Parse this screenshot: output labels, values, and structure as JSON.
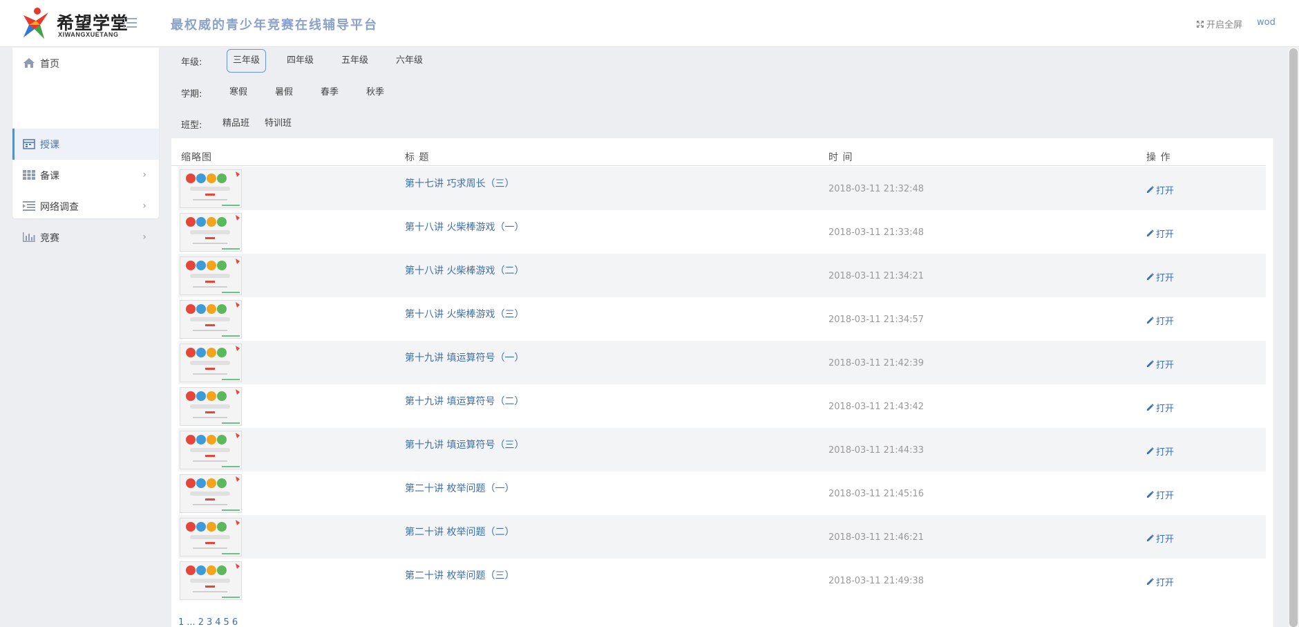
{
  "header": {
    "logo_text": "希望学堂",
    "logo_sub": "XIWANGXUETANG",
    "slogan": "最权威的青少年竞赛在线辅导平台",
    "fullscreen_label": "开启全屏",
    "user_name": "wod"
  },
  "sidebar": {
    "items": [
      {
        "label": "首页",
        "icon": "home-icon",
        "active": false,
        "has_children": false
      },
      {
        "label": "授课",
        "icon": "calendar-icon",
        "active": true,
        "has_children": false
      },
      {
        "label": "备课",
        "icon": "grid-icon",
        "active": false,
        "has_children": true
      },
      {
        "label": "网络调查",
        "icon": "list-indent-icon",
        "active": false,
        "has_children": true
      },
      {
        "label": "竞赛",
        "icon": "bar-chart-icon",
        "active": false,
        "has_children": true
      }
    ]
  },
  "filters": {
    "grade": {
      "label": "年级:",
      "options": [
        "三年级",
        "四年级",
        "五年级",
        "六年级"
      ],
      "selected": "三年级"
    },
    "term": {
      "label": "学期:",
      "options": [
        "寒假",
        "暑假",
        "春季",
        "秋季"
      ]
    },
    "class_type": {
      "label": "班型:",
      "options": [
        "精品班",
        "特训班"
      ]
    }
  },
  "table": {
    "columns": [
      "缩略图",
      "标 题",
      "时 间",
      "操 作"
    ],
    "open_label": "打开",
    "rows": [
      {
        "title": "第十七讲 巧求周长（三）",
        "time": "2018-03-11 21:32:48"
      },
      {
        "title": "第十八讲 火柴棒游戏（一）",
        "time": "2018-03-11 21:33:48"
      },
      {
        "title": "第十八讲 火柴棒游戏（二）",
        "time": "2018-03-11 21:34:21"
      },
      {
        "title": "第十八讲 火柴棒游戏（三）",
        "time": "2018-03-11 21:34:57"
      },
      {
        "title": "第十九讲 填运算符号（一）",
        "time": "2018-03-11 21:42:39"
      },
      {
        "title": "第十九讲 填运算符号（二）",
        "time": "2018-03-11 21:43:42"
      },
      {
        "title": "第十九讲 填运算符号（三）",
        "time": "2018-03-11 21:44:33"
      },
      {
        "title": "第二十讲 枚举问题（一）",
        "time": "2018-03-11 21:45:16"
      },
      {
        "title": "第二十讲 枚举问题（二）",
        "time": "2018-03-11 21:46:21"
      },
      {
        "title": "第二十讲 枚举问题（三）",
        "time": "2018-03-11 21:49:38"
      }
    ]
  },
  "pagination": {
    "pages": [
      "1",
      "...",
      "2",
      "3",
      "4",
      "5",
      "6"
    ]
  },
  "colors": {
    "accent": "#3d6fae",
    "slogan": "#8aa2c9",
    "page_bg": "#eceef2",
    "row_alt": "#f3f4f6"
  }
}
